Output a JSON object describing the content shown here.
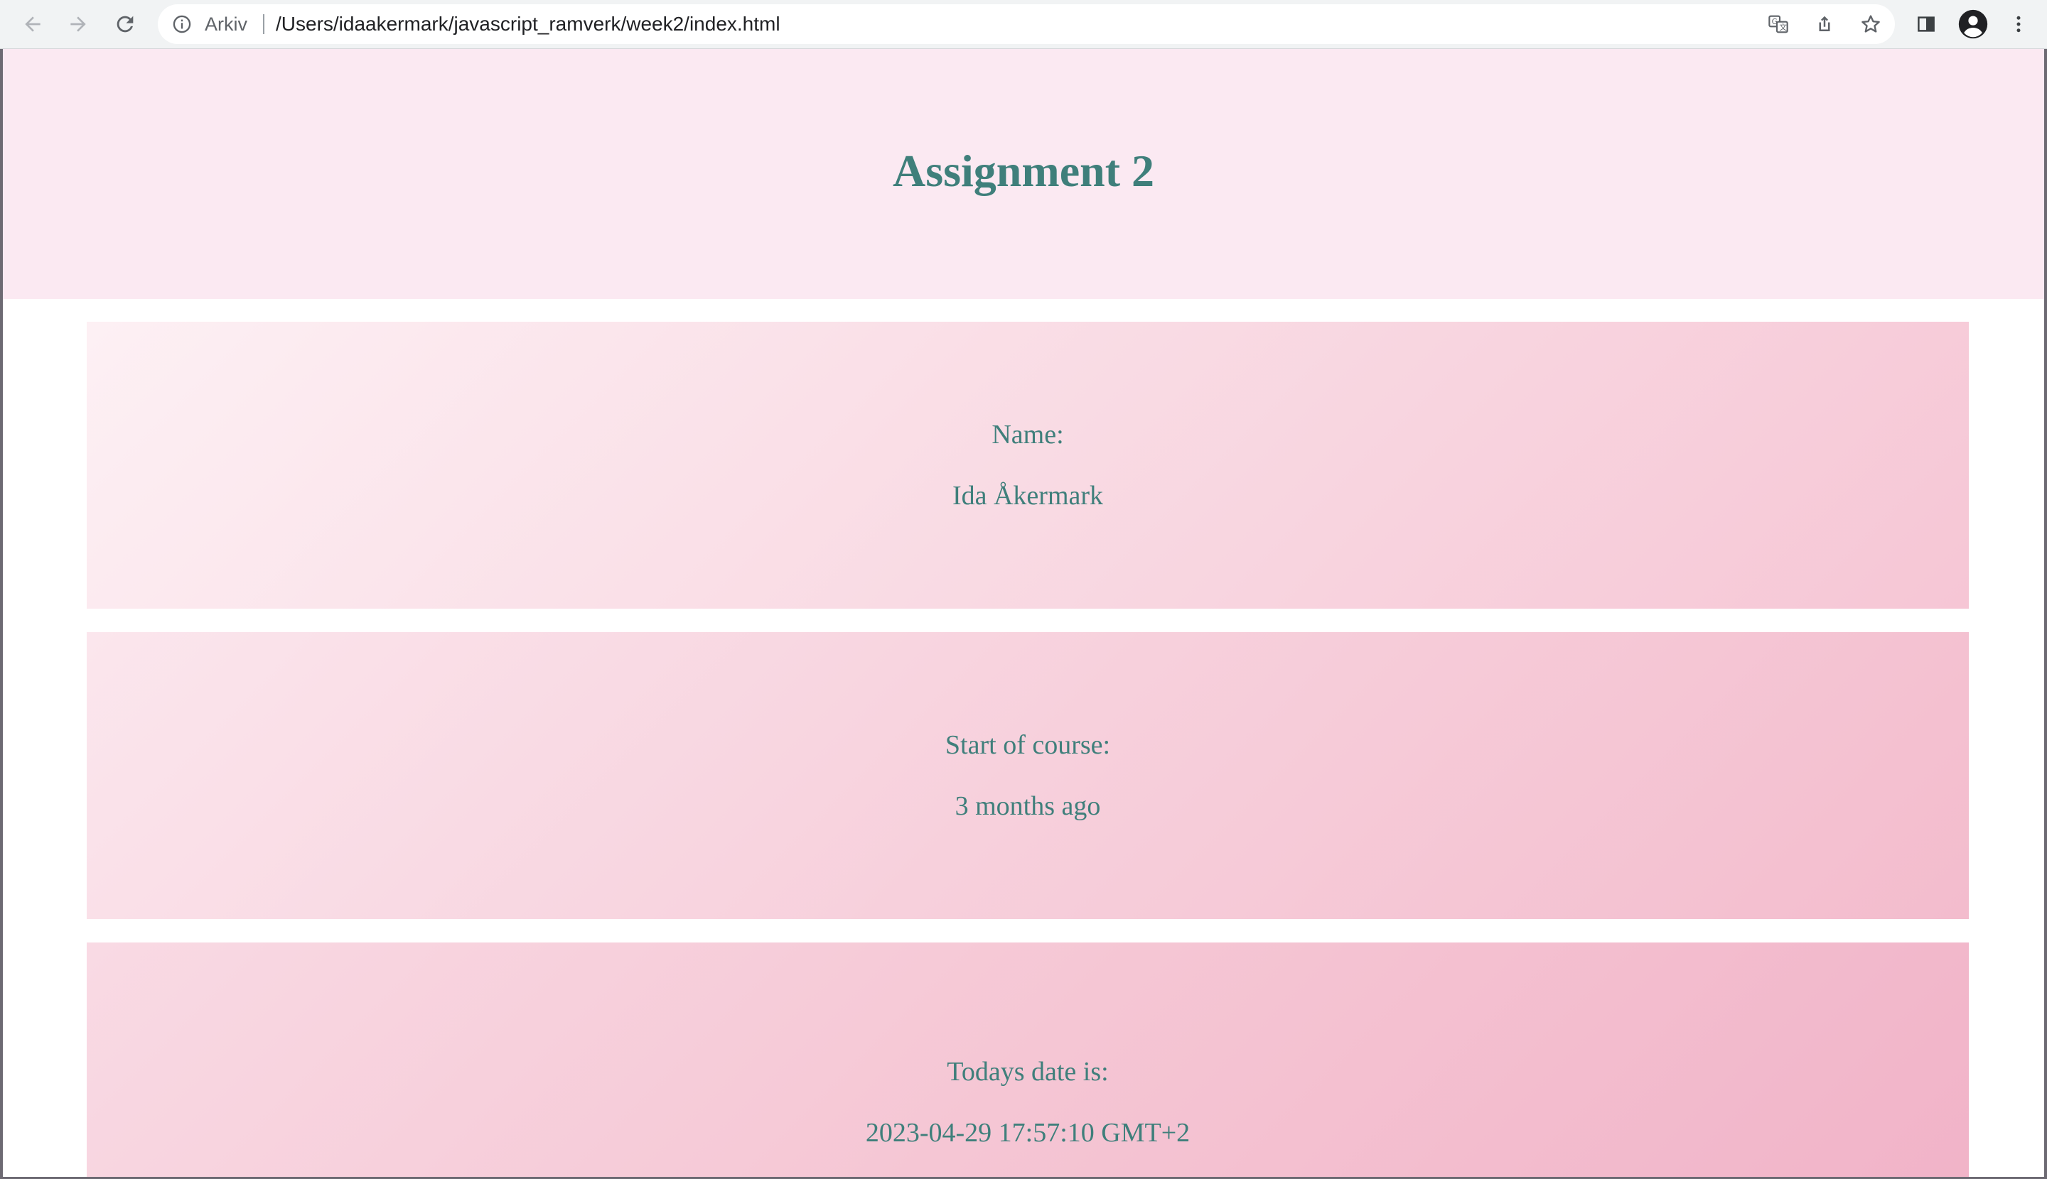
{
  "browser": {
    "omnibox": {
      "chip_label": "Arkiv",
      "url": "/Users/idaakermark/javascript_ramverk/week2/index.html"
    },
    "icons": {
      "back": "arrow-left-icon",
      "forward": "arrow-right-icon",
      "reload": "reload-icon",
      "site_info": "info-icon",
      "translate": "translate-icon",
      "share": "share-icon",
      "bookmark": "star-icon",
      "side_panel": "side-panel-icon",
      "profile": "profile-icon",
      "menu": "kebab-menu-icon"
    }
  },
  "page": {
    "title": "Assignment 2",
    "colors": {
      "header_bg": "#fbe9f2",
      "text": "#3f7f7b",
      "card_gradient_start": "#fdeff3",
      "card_gradient_end": "#f3b4c8"
    },
    "cards": [
      {
        "label": "Name:",
        "value": "Ida Åkermark"
      },
      {
        "label": "Start of course:",
        "value": "3 months ago"
      },
      {
        "label": "Todays date is:",
        "value": "2023-04-29 17:57:10 GMT+2"
      }
    ]
  }
}
